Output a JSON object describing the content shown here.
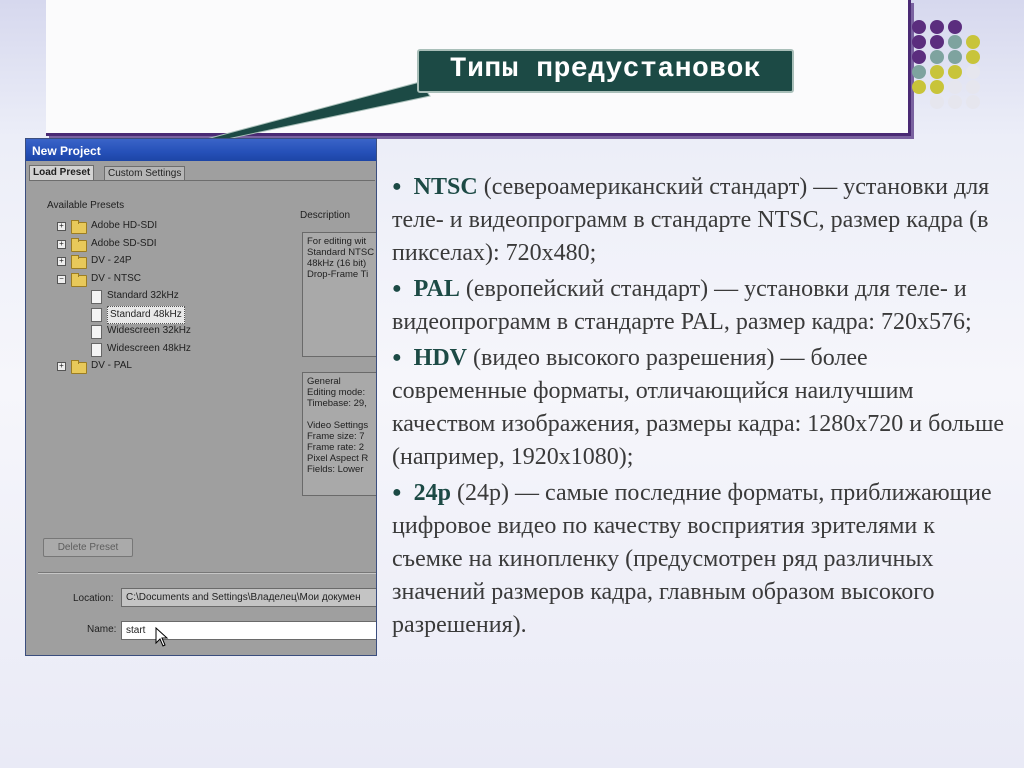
{
  "slide": {
    "title": "Типы предустановок",
    "colors": {
      "title_bg": "#1c4a45",
      "accent_frame": "#4a2a74",
      "dot_purple": "#5b2d7e",
      "dot_teal": "#7ea39f",
      "dot_yellow": "#c8c43a",
      "dot_light": "#e6e6ee"
    },
    "bullets": [
      {
        "key": "NTSC",
        "text": "(североамериканский стандарт) — установки для теле- и видеопрограмм в стандарте NTSC, размер кадра (в пикселах): 720x480;"
      },
      {
        "key": "PAL",
        "text": "(европейский стандарт) — установки для теле- и видеопрограмм в стандарте PAL, размер кадра: 720x576;"
      },
      {
        "key": "HDV",
        "text": "(видео высокого разрешения) — более современные форматы, отличающийся наилучшим качеством изображения, размеры кадра: 1280x720 и больше (например, 1920x1080);"
      },
      {
        "key": "24p",
        "text": "(24р) — самые последние форматы, приближающие цифровое видео по качеству восприятия зрителями к съемке на кинопленку (предусмотрен ряд различных значений размеров кадра, главным образом высокого разрешения)."
      }
    ]
  },
  "dialog": {
    "title": "New Project",
    "tabs": [
      "Load Preset",
      "Custom Settings"
    ],
    "available_presets_label": "Available Presets",
    "description_label": "Description",
    "tree": [
      {
        "label": "Adobe HD-SDI",
        "type": "folder",
        "expanded": false
      },
      {
        "label": "Adobe SD-SDI",
        "type": "folder",
        "expanded": false
      },
      {
        "label": "DV - 24P",
        "type": "folder",
        "expanded": false
      },
      {
        "label": "DV - NTSC",
        "type": "folder",
        "expanded": true
      },
      {
        "label": "Standard 32kHz",
        "type": "file"
      },
      {
        "label": "Standard 48kHz",
        "type": "file",
        "selected": true
      },
      {
        "label": "Widescreen 32kHz",
        "type": "file"
      },
      {
        "label": "Widescreen 48kHz",
        "type": "file"
      },
      {
        "label": "DV - PAL",
        "type": "folder",
        "expanded": false
      }
    ],
    "description_lines": [
      "For editing wit",
      "Standard NTSC",
      "48kHz (16 bit)",
      "Drop-Frame Ti"
    ],
    "general_lines": [
      "General",
      " Editing mode:",
      " Timebase: 29,",
      "",
      "Video Settings",
      " Frame size: 7",
      " Frame rate: 2",
      " Pixel Aspect R",
      " Fields: Lower"
    ],
    "delete_button": "Delete Preset",
    "location_label": "Location:",
    "location_value": "C:\\Documents and Settings\\Владелец\\Мои докумен",
    "name_label": "Name:",
    "name_value": "start"
  }
}
